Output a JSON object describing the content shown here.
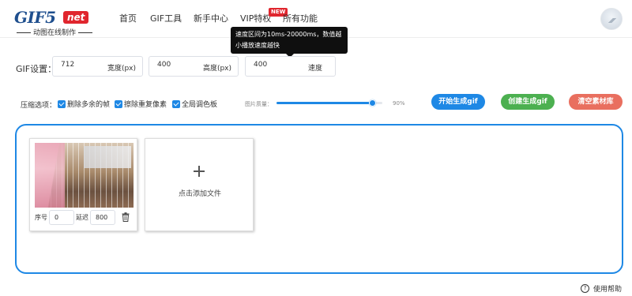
{
  "logo": {
    "main": "GIF5",
    "badge": "net",
    "tagline": "动图在线制作"
  },
  "nav": [
    {
      "label": "首页"
    },
    {
      "label": "GIF工具"
    },
    {
      "label": "新手中心"
    },
    {
      "label": "VIP特权",
      "badge": "NEW"
    },
    {
      "label": "所有功能"
    }
  ],
  "tooltip": {
    "text": "速度区间为10ms-20000ms，数值越小播放速度越快"
  },
  "settings": {
    "label": "GIF设置：",
    "width": {
      "value": "712",
      "suffix": "宽度(px)"
    },
    "height": {
      "value": "400",
      "suffix": "高度(px)"
    },
    "speed": {
      "value": "400",
      "suffix": "速度"
    }
  },
  "options": {
    "label": "压缩选项：",
    "checkboxes": [
      {
        "label": "删除多余的帧",
        "checked": true
      },
      {
        "label": "擦除重复像素",
        "checked": true
      },
      {
        "label": "全局调色板",
        "checked": true
      }
    ],
    "quality_label": "图片质量：",
    "quality_value": "90%",
    "quality_fraction": 0.9
  },
  "buttons": {
    "start": "开始生成gif",
    "create": "创建生成gif",
    "clear": "清空素材库"
  },
  "frames": [
    {
      "index_label": "序号",
      "index": "0",
      "delay_label": "延迟",
      "delay": "800"
    }
  ],
  "add_file": {
    "label": "点击添加文件"
  },
  "help": {
    "label": "使用帮助",
    "icon": "?"
  },
  "colors": {
    "accent": "#1e88e5",
    "create": "#4cb050",
    "clear": "#e96f5f",
    "brand": "#1f4f8e",
    "badge": "#e0262e"
  }
}
